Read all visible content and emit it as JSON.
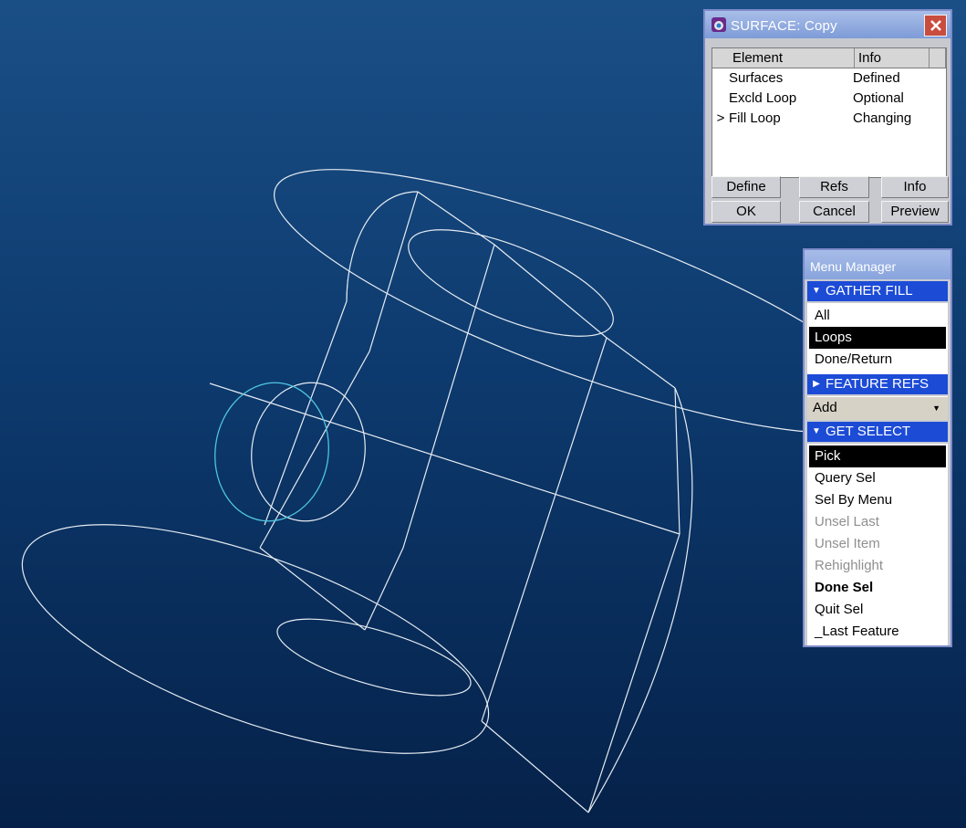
{
  "surface_dialog": {
    "title": "SURFACE: Copy",
    "columns": [
      "Element",
      "Info"
    ],
    "rows": [
      {
        "marker": "",
        "element": "Surfaces",
        "info": "Defined"
      },
      {
        "marker": "",
        "element": "Excld Loop",
        "info": "Optional"
      },
      {
        "marker": ">",
        "element": "Fill Loop",
        "info": "Changing"
      }
    ],
    "buttons": {
      "define": "Define",
      "refs": "Refs",
      "info": "Info",
      "ok": "OK",
      "cancel": "Cancel",
      "preview": "Preview"
    }
  },
  "menu_manager": {
    "title": "Menu Manager",
    "gather_fill": {
      "label": "GATHER FILL",
      "items": [
        {
          "label": "All",
          "state": "normal"
        },
        {
          "label": "Loops",
          "state": "selected"
        },
        {
          "label": "Done/Return",
          "state": "normal"
        }
      ]
    },
    "feature_refs": {
      "label": "FEATURE REFS",
      "combo_value": "Add"
    },
    "get_select": {
      "label": "GET SELECT",
      "items": [
        {
          "label": "Pick",
          "state": "selected"
        },
        {
          "label": "Query Sel",
          "state": "normal"
        },
        {
          "label": "Sel By Menu",
          "state": "normal"
        },
        {
          "label": "Unsel Last",
          "state": "disabled"
        },
        {
          "label": "Unsel Item",
          "state": "disabled"
        },
        {
          "label": "Rehighlight",
          "state": "disabled"
        },
        {
          "label": "Done Sel",
          "state": "bold"
        },
        {
          "label": "Quit Sel",
          "state": "normal"
        },
        {
          "label": "_Last Feature",
          "state": "normal"
        }
      ]
    }
  },
  "colors": {
    "background_top": "#1a4f86",
    "background_bottom": "#052149",
    "wire": "#e6ecf2",
    "highlight_wire": "#4fc6e0",
    "menu_header": "#1c4bd6",
    "selected_item": "#000000"
  }
}
